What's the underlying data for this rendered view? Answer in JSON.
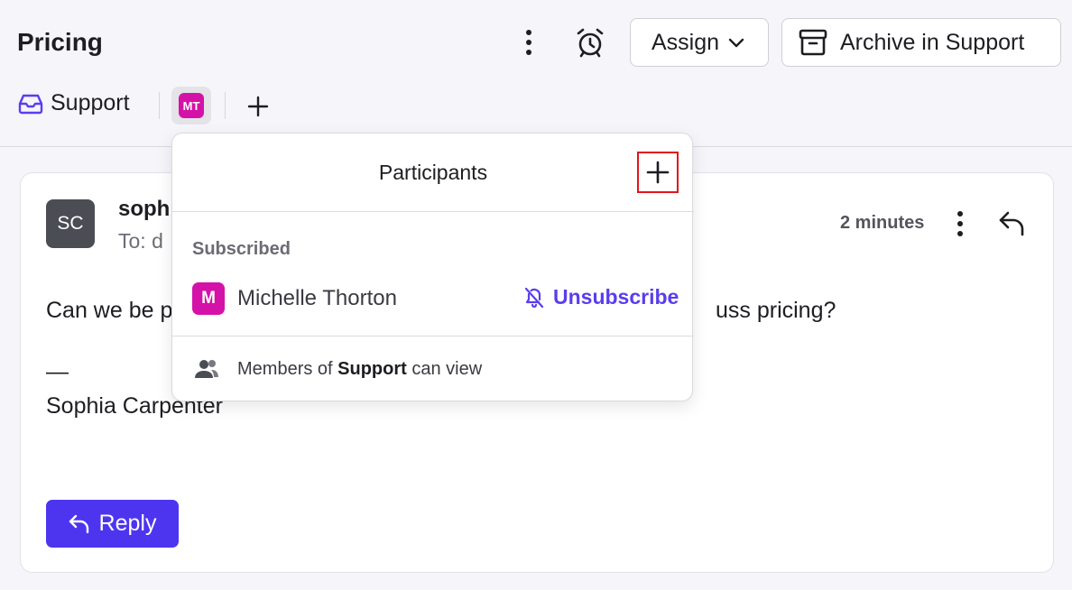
{
  "header": {
    "title": "Pricing",
    "assign_label": "Assign",
    "archive_label": "Archive in Support"
  },
  "tags": {
    "inbox_label": "Support",
    "participant_initials": "MT"
  },
  "message": {
    "sender_initials": "SC",
    "sender_name": "soph",
    "to_text": "To: d",
    "timestamp": "2 minutes",
    "body_start": "Can we be p",
    "body_end": "uss pricing?",
    "signature_dash": "—",
    "signature_name": "Sophia Carpenter",
    "reply_label": "Reply"
  },
  "popover": {
    "title": "Participants",
    "section_label": "Subscribed",
    "member_initial": "M",
    "member_name": "Michelle Thorton",
    "unsubscribe_label": "Unsubscribe",
    "footer_prefix": "Members of",
    "footer_team": "Support",
    "footer_suffix": "can view"
  },
  "colors": {
    "accent": "#4d35f0",
    "participant_avatar": "#d412a8",
    "highlight": "#e3141b"
  },
  "icons": [
    "more-vertical-icon",
    "alarm-clock-icon",
    "chevron-down-icon",
    "archive-icon",
    "inbox-icon",
    "plus-icon",
    "reply-icon",
    "bell-off-icon",
    "users-icon"
  ]
}
